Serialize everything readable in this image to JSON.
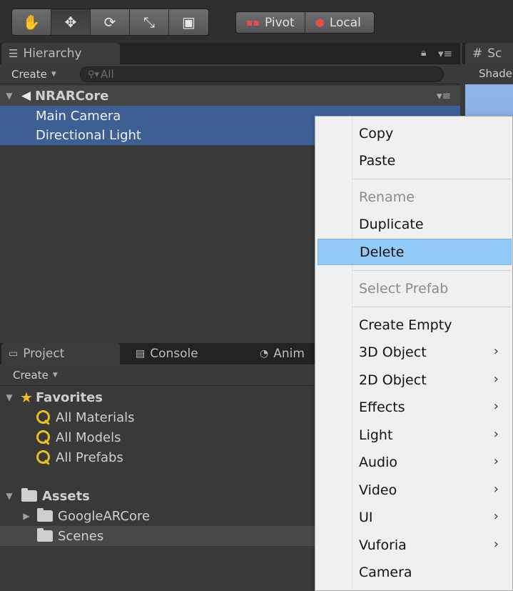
{
  "toolbar": {
    "tools": [
      {
        "icon": "hand-icon",
        "glyph": "✋"
      },
      {
        "icon": "move-icon",
        "glyph": "✥"
      },
      {
        "icon": "rotate-icon",
        "glyph": "⟳"
      },
      {
        "icon": "scale-icon",
        "glyph": "⤡"
      },
      {
        "icon": "rect-tool-icon",
        "glyph": "▣"
      }
    ],
    "pivot_label": "Pivot",
    "local_label": "Local"
  },
  "hierarchy": {
    "tab_label": "Hierarchy",
    "create_label": "Create",
    "search_placeholder": "All",
    "scene_name": "NRARCore",
    "items": [
      "Main Camera",
      "Directional Light"
    ]
  },
  "scene_tab": {
    "label": "Sc",
    "shading_label": "Shade"
  },
  "bottom_tabs": {
    "project_label": "Project",
    "console_label": "Console",
    "animation_label": "Anim"
  },
  "project": {
    "create_label": "Create",
    "favorites_label": "Favorites",
    "favorites": [
      "All Materials",
      "All Models",
      "All Prefabs"
    ],
    "assets_label": "Assets",
    "assets": [
      "GoogleARCore",
      "Scenes"
    ]
  },
  "context_menu": {
    "copy": "Copy",
    "paste": "Paste",
    "rename": "Rename",
    "duplicate": "Duplicate",
    "delete": "Delete",
    "select_prefab": "Select Prefab",
    "create_empty": "Create Empty",
    "object_3d": "3D Object",
    "object_2d": "2D Object",
    "effects": "Effects",
    "light": "Light",
    "audio": "Audio",
    "video": "Video",
    "ui": "UI",
    "vuforia": "Vuforia",
    "camera": "Camera"
  },
  "colors": {
    "selection": "#3d5f94",
    "menu_highlight": "#91c9f7",
    "favorites_star": "#f0c020"
  }
}
